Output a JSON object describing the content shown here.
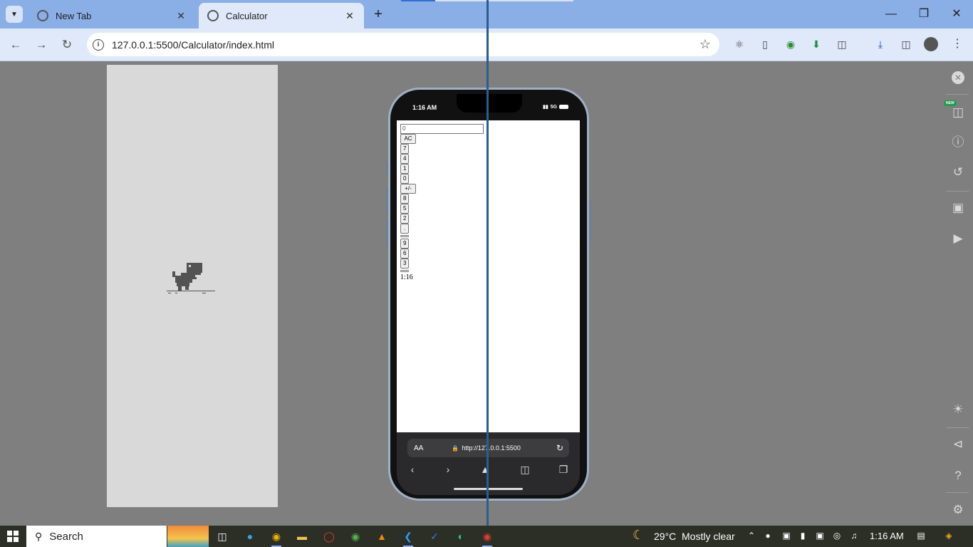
{
  "browser": {
    "tabs": [
      {
        "label": "New Tab",
        "active": false
      },
      {
        "label": "Calculator",
        "active": true
      }
    ],
    "new_tab": "+",
    "url": "127.0.0.1:5500/Calculator/index.html"
  },
  "phone": {
    "status_time": "1:16 AM",
    "status_network": "5G",
    "calculator": {
      "display_value": "0",
      "buttons": [
        "AC",
        "7",
        "4",
        "1",
        "0",
        "+/-",
        "8",
        "5",
        "2",
        ".",
        "",
        "9",
        "6",
        "3",
        ""
      ],
      "clock": "1:16"
    },
    "safari_aa": "AA",
    "safari_url": "http://127.0.0.1:5500"
  },
  "devtools": {
    "new_badge": "NEW"
  },
  "taskbar": {
    "search_label": "Search",
    "weather_temp": "29°C",
    "weather_desc": "Mostly clear",
    "time": "1:16 AM"
  },
  "colors": {
    "tab_strip": "#8aaee6",
    "toolbar": "#dfe9fa",
    "viewport_bg": "#7f7f7f",
    "taskbar": "#2b2f26"
  }
}
